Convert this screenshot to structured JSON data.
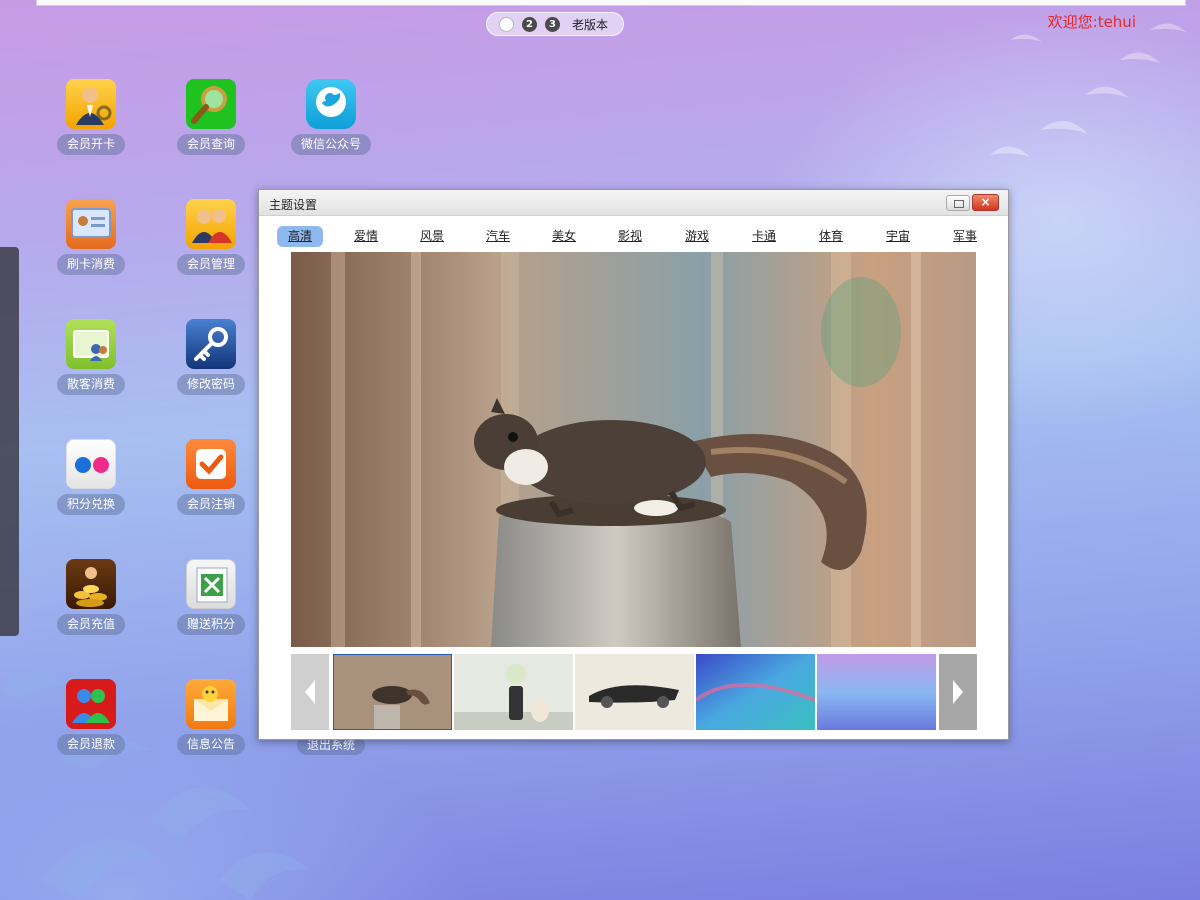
{
  "header": {
    "welcome": "欢迎您:tehui",
    "pager": {
      "pages": [
        "1",
        "2",
        "3"
      ],
      "active_page": "1",
      "old_version": "老版本"
    }
  },
  "apps": [
    {
      "label": "会员开卡",
      "icon": "member-open-card-icon"
    },
    {
      "label": "会员查询",
      "icon": "member-search-icon"
    },
    {
      "label": "微信公众号",
      "icon": "wechat-account-icon"
    },
    {
      "label": "刷卡消费",
      "icon": "card-consume-icon"
    },
    {
      "label": "会员管理",
      "icon": "member-manage-icon"
    },
    {
      "label": "散客消费",
      "icon": "guest-consume-icon"
    },
    {
      "label": "修改密码",
      "icon": "key-icon"
    },
    {
      "label": "积分兑换",
      "icon": "points-exchange-icon"
    },
    {
      "label": "会员注销",
      "icon": "member-cancel-icon"
    },
    {
      "label": "会员充值",
      "icon": "coins-icon"
    },
    {
      "label": "赠送积分",
      "icon": "gift-points-icon"
    },
    {
      "label": "会员退款",
      "icon": "member-refund-icon"
    },
    {
      "label": "信息公告",
      "icon": "announcement-icon"
    },
    {
      "label": "退出系统",
      "icon": "exit-icon"
    }
  ],
  "dialog": {
    "title": "主题设置",
    "close_label": "×",
    "tabs": [
      "高清",
      "爱情",
      "风景",
      "汽车",
      "美女",
      "影视",
      "游戏",
      "卡通",
      "体育",
      "宇宙",
      "军事"
    ],
    "active_tab": "高清",
    "preview": "squirrel-on-post-photo",
    "thumbnails": [
      "squirrel-photo",
      "cat-and-vase-photo",
      "car-sketch-photo",
      "blue-abstract-photo",
      "purple-abstract-photo"
    ],
    "selected_thumbnail": "squirrel-photo"
  },
  "colors": {
    "welcome_text": "#e8262a",
    "active_tab": "#8db8f0",
    "close_button": "#d2361e"
  }
}
